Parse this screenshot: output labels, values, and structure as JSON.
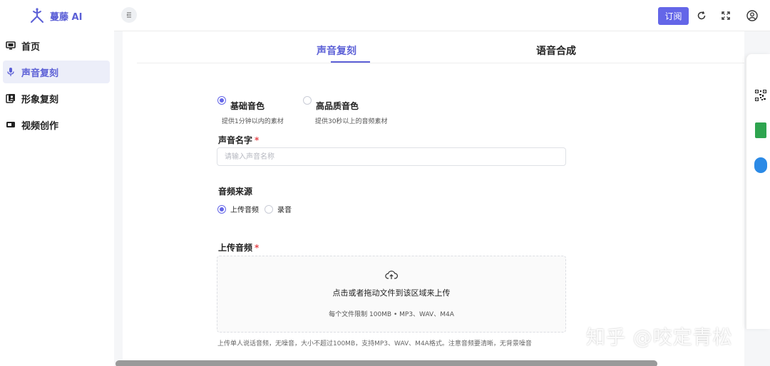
{
  "app": {
    "logo_text": "蔓藤 AI"
  },
  "sidebar": {
    "items": [
      {
        "label": "首页",
        "icon": "monitor-icon",
        "active": false
      },
      {
        "label": "声音复刻",
        "icon": "microphone-icon",
        "active": true
      },
      {
        "label": "形象复刻",
        "icon": "portrait-icon",
        "active": false
      },
      {
        "label": "视频创作",
        "icon": "video-camera-icon",
        "active": false
      }
    ]
  },
  "topbar": {
    "collapse_icon": "collapse-sidebar-icon",
    "subscribe_label": "订阅",
    "icons": [
      "refresh-icon",
      "fullscreen-icon",
      "user-icon"
    ]
  },
  "tabs": [
    {
      "label": "声音复刻",
      "active": true
    },
    {
      "label": "语音合成",
      "active": false
    }
  ],
  "form": {
    "quality": {
      "options": [
        {
          "title": "基础音色",
          "desc": "提供1分钟以内的素材",
          "selected": true
        },
        {
          "title": "高品质音色",
          "desc": "提供30秒以上的音频素材",
          "selected": false
        }
      ]
    },
    "name": {
      "label": "声音名字",
      "required_mark": "*",
      "placeholder": "请输入声音名称",
      "value": ""
    },
    "source": {
      "label": "音频来源",
      "options": [
        {
          "label": "上传音频",
          "selected": true
        },
        {
          "label": "录音",
          "selected": false
        }
      ]
    },
    "upload": {
      "label": "上传音频",
      "required_mark": "*",
      "icon": "cloud-upload-icon",
      "title": "点击或者拖动文件到该区域来上传",
      "limit": "每个文件限制 100MB • MP3、WAV、M4A",
      "hint": "上传单人说话音频，无噪音，大小不超过100MB，支持MP3、WAV、M4A格式。注意音频要清晰，无背景噪音"
    }
  },
  "float_panel": {
    "icons": [
      "qr-code-icon",
      "wechat-icon",
      "document-icon"
    ]
  },
  "watermark": "知乎 @咬定青松",
  "colors": {
    "accent": "#6466e8",
    "active_bg": "#eceef9",
    "required": "#e5484d"
  }
}
